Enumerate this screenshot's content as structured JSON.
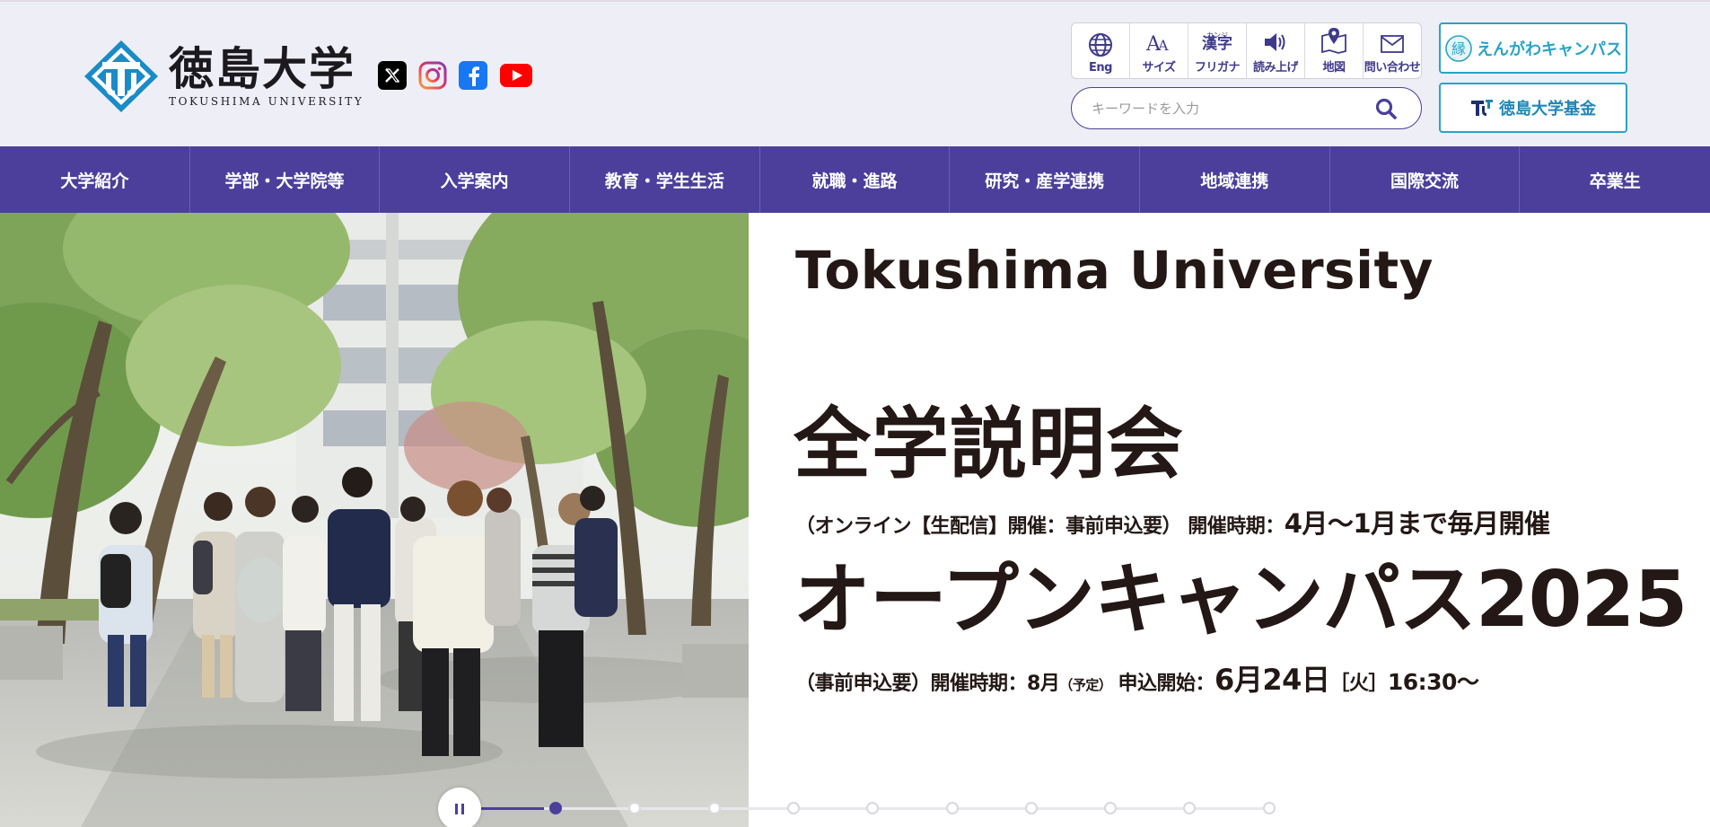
{
  "logo": {
    "name_ja": "徳島大学",
    "name_en": "TOKUSHIMA UNIVERSITY"
  },
  "sns": [
    {
      "name": "x-icon"
    },
    {
      "name": "instagram-icon"
    },
    {
      "name": "facebook-icon"
    },
    {
      "name": "youtube-icon"
    }
  ],
  "tools": {
    "eng": "Eng",
    "size": "サイズ",
    "furigana_kanji": "漢字",
    "furigana_ruby": "カンジ",
    "furigana": "フリガナ",
    "read": "読み上げ",
    "map": "地図",
    "contact": "問い合わせ"
  },
  "search": {
    "placeholder": "キーワードを入力"
  },
  "links": {
    "engawa": "えんがわキャンパス",
    "kikin": "徳島大学基金"
  },
  "nav": [
    "大学紹介",
    "学部・大学院等",
    "入学案内",
    "教育・学生生活",
    "就職・進路",
    "研究・産学連携",
    "地域連携",
    "国際交流",
    "卒業生"
  ],
  "hero": {
    "title": "Tokushima University",
    "event1_title": "全学説明会",
    "event1_note": "（オンライン【生配信】開催：事前申込要）",
    "event1_period_label": "開催時期：",
    "event1_period": "4月〜1月まで毎月開催",
    "event2_title": "オープンキャンパス2025",
    "event2_note": "（事前申込要）",
    "event2_period_label": "開催時期：",
    "event2_month": "8月",
    "event2_tentative": "（予定）",
    "event2_apply_label": "申込開始：",
    "event2_apply_date": "6月24日",
    "event2_apply_day": "［火］",
    "event2_apply_time": "16:30〜"
  },
  "slider": {
    "total": 10,
    "active_index": 0,
    "progress": 0.08
  },
  "colors": {
    "primary": "#4b3f9b",
    "accent": "#2aa3c6",
    "header_bg": "#eeeff6"
  }
}
